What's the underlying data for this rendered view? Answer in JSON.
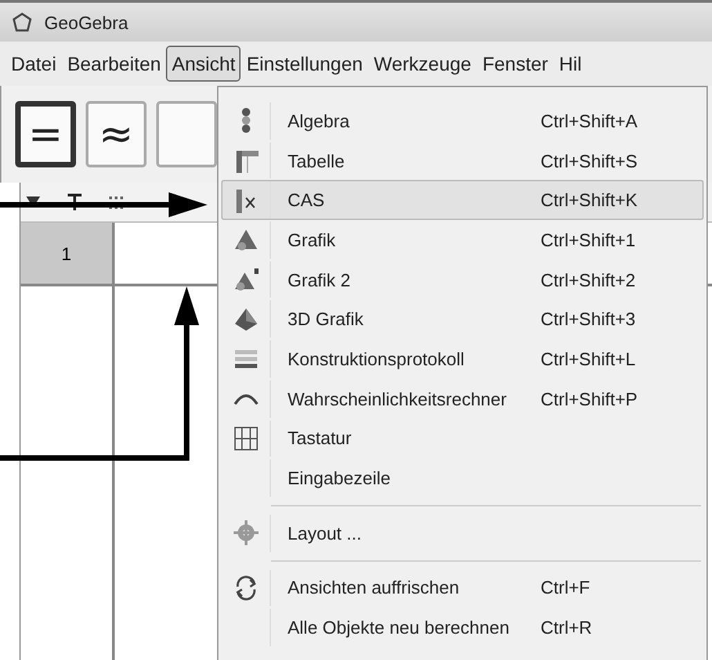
{
  "window": {
    "title": "GeoGebra"
  },
  "menubar": [
    {
      "label": "Datei",
      "selected": false
    },
    {
      "label": "Bearbeiten",
      "selected": false
    },
    {
      "label": "Ansicht",
      "selected": true
    },
    {
      "label": "Einstellungen",
      "selected": false
    },
    {
      "label": "Werkzeuge",
      "selected": false
    },
    {
      "label": "Fenster",
      "selected": false
    },
    {
      "label": "Hil",
      "selected": false
    }
  ],
  "toolbar": [
    {
      "label": "=",
      "selected": true
    },
    {
      "label": "≈",
      "selected": false
    },
    {
      "selected": false
    }
  ],
  "cas": {
    "rows": [
      {
        "number": "1"
      }
    ]
  },
  "menu": [
    {
      "kind": "item",
      "label": "Algebra",
      "shortcut": "Ctrl+Shift+A",
      "selected": false
    },
    {
      "kind": "item",
      "label": "Tabelle",
      "shortcut": "Ctrl+Shift+S",
      "selected": false
    },
    {
      "kind": "item",
      "label": "CAS",
      "shortcut": "Ctrl+Shift+K",
      "selected": true
    },
    {
      "kind": "item",
      "label": "Grafik",
      "shortcut": "Ctrl+Shift+1",
      "selected": false
    },
    {
      "kind": "item",
      "label": "Grafik 2",
      "shortcut": "Ctrl+Shift+2",
      "selected": false
    },
    {
      "kind": "item",
      "label": "3D Grafik",
      "shortcut": "Ctrl+Shift+3",
      "selected": false
    },
    {
      "kind": "item",
      "label": "Konstruktionsprotokoll",
      "shortcut": "Ctrl+Shift+L",
      "selected": false
    },
    {
      "kind": "item",
      "label": "Wahrscheinlichkeitsrechner",
      "shortcut": "Ctrl+Shift+P",
      "selected": false
    },
    {
      "kind": "item",
      "label": "Tastatur",
      "selected": false
    },
    {
      "kind": "item",
      "label": "Eingabezeile",
      "selected": false
    },
    {
      "kind": "separator"
    },
    {
      "kind": "item",
      "label": "Layout ...",
      "selected": false
    },
    {
      "kind": "separator"
    },
    {
      "kind": "item",
      "label": "Ansichten auffrischen",
      "shortcut": "Ctrl+F",
      "selected": false
    },
    {
      "kind": "item",
      "label": "Alle Objekte neu berechnen",
      "shortcut": "Ctrl+R",
      "selected": false
    }
  ]
}
